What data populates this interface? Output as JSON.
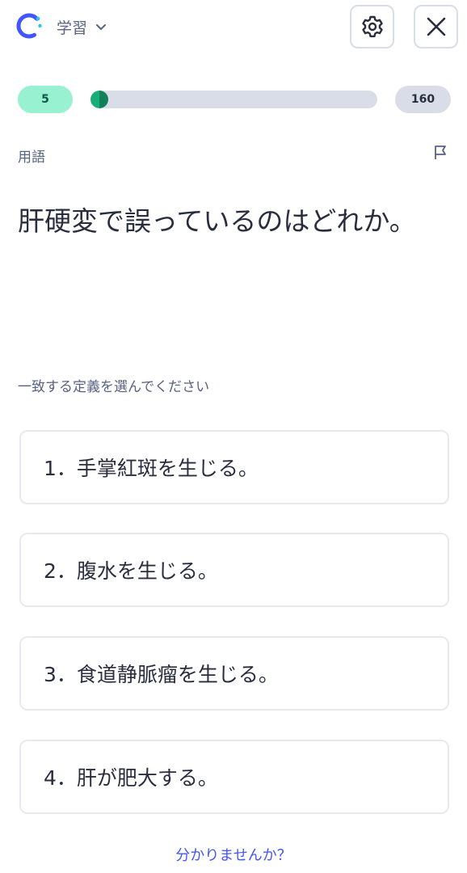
{
  "header": {
    "logo_icon": "quizlet-ring-icon",
    "mode_label": "学習",
    "settings_icon": "gear-icon",
    "close_icon": "close-icon"
  },
  "progress": {
    "done": "5",
    "total": "160",
    "fraction": 0.031
  },
  "card": {
    "term_label": "用語",
    "flag_icon": "flag-icon",
    "question": "肝硬変で誤っているのはどれか。",
    "instruction": "一致する定義を選んでください",
    "options": [
      "1．手掌紅斑を生じる。",
      "2．腹水を生じる。",
      "3．食道静脈瘤を生じる。",
      "4．肝が肥大する。"
    ],
    "dont_know": "分かりませんか？"
  },
  "colors": {
    "accent_blue": "#4255ff",
    "progress_green": "#18ae79",
    "done_pill": "#98f1d1",
    "track": "#d9dde8"
  }
}
